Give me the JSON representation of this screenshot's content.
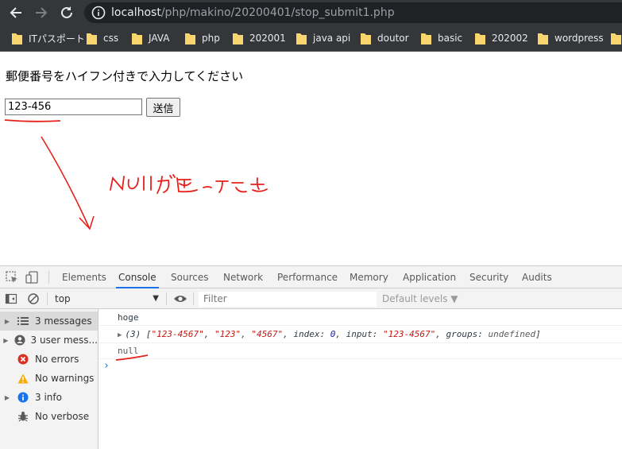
{
  "browser": {
    "url_host": "localhost",
    "url_path": "/php/makino/20200401/stop_submit1.php"
  },
  "bookmarks": [
    {
      "label": "ITパスポート"
    },
    {
      "label": "css"
    },
    {
      "label": "JAVA"
    },
    {
      "label": "php"
    },
    {
      "label": "202001"
    },
    {
      "label": "java api"
    },
    {
      "label": "doutor"
    },
    {
      "label": "basic"
    },
    {
      "label": "202002"
    },
    {
      "label": "wordpress"
    }
  ],
  "page": {
    "prompt": "郵便番号をハイフン付きで入力してください",
    "zip_value": "123-456",
    "submit_label": "送信"
  },
  "devtools": {
    "tabs": [
      "Elements",
      "Console",
      "Sources",
      "Network",
      "Performance",
      "Memory",
      "Application",
      "Security",
      "Audits"
    ],
    "active_tab": "Console",
    "context": "top",
    "filter_placeholder": "Filter",
    "levels_label": "Default levels ▼",
    "sidebar": [
      {
        "label": "3 messages",
        "icon": "list-icon"
      },
      {
        "label": "3 user mess...",
        "icon": "user-icon"
      },
      {
        "label": "No errors",
        "icon": "error-icon"
      },
      {
        "label": "No warnings",
        "icon": "warning-icon"
      },
      {
        "label": "3 info",
        "icon": "info-icon"
      },
      {
        "label": "No verbose",
        "icon": "bug-icon"
      }
    ],
    "console": {
      "line1": "hoge",
      "line2": {
        "count": "(3) [",
        "s1": "\"123-4567\"",
        "s2": "\"123\"",
        "s3": "\"4567\"",
        "index_key": "index:",
        "index_val": "0",
        "input_key": "input:",
        "input_val": "\"123-4567\"",
        "groups_key": "groups:",
        "groups_val": "undefined",
        "close": "]"
      },
      "line3": "null",
      "prompt": "›"
    }
  },
  "annotation": {
    "handwritten_note": "NULLが返った",
    "color": "#e8201a"
  },
  "colors": {
    "chrome_dark": "#35363a",
    "omnibox": "#202124",
    "accent": "#1a73e8",
    "error": "#d93025",
    "warning": "#f9ab00"
  }
}
